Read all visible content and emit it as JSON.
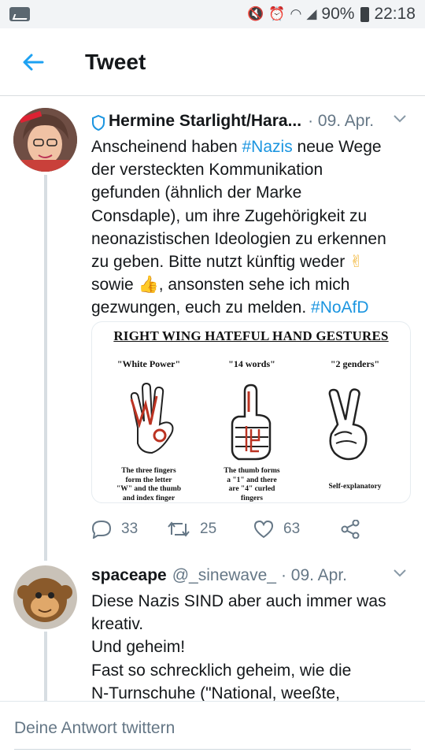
{
  "status_bar": {
    "battery": "90%",
    "time": "22:18",
    "icons": [
      "mute-icon",
      "alarm-icon",
      "wifi-icon",
      "signal-icon",
      "battery-icon"
    ]
  },
  "header": {
    "title": "Tweet",
    "back_icon": "back-arrow-icon"
  },
  "tweets": [
    {
      "name": "Hermine Starlight/Hara...",
      "date": "· 09. Apr.",
      "lines": [
        [
          "Anscheinend haben ",
          "#Nazis",
          " neue Wege"
        ],
        [
          "der versteckten Kommunikation"
        ],
        [
          "gefunden (ähnlich der Marke"
        ],
        [
          "Consdaple), um ihre Zugehörigkeit zu"
        ],
        [
          "neonazistischen Ideologien zu erkennen"
        ],
        [
          "zu geben. Bitte nutzt künftig weder ",
          "✌"
        ],
        [
          "sowie ",
          "👍",
          ", ansonsten sehe ich mich"
        ],
        [
          "gezwungen, euch zu melden. ",
          "#NoAfD"
        ]
      ],
      "card": {
        "title": "RIGHT WING HATEFUL HAND GESTURES",
        "gestures": [
          {
            "label": "\"White Power\"",
            "caption": [
              "The three fingers",
              "form the letter",
              "\"W\" and the thumb",
              "and index finger"
            ]
          },
          {
            "label": "\"14 words\"",
            "caption": [
              "The thumb forms",
              "a \"1\" and there",
              "are \"4\" curled",
              "fingers"
            ]
          },
          {
            "label": "\"2 genders\"",
            "caption": [
              "Self-explanatory"
            ]
          }
        ]
      },
      "actions": {
        "replies": "33",
        "retweets": "25",
        "likes": "63"
      }
    },
    {
      "name": "spaceape",
      "handle": "@_sinewave_",
      "date": "· 09. Apr.",
      "lines": [
        [
          "Diese Nazis SIND aber auch immer was"
        ],
        [
          "kreativ."
        ],
        [
          "Und geheim!"
        ],
        [
          "Fast so schrecklich geheim, wie die"
        ],
        [
          "N-Turnschuhe (\"National, weeßte,"
        ]
      ]
    }
  ],
  "reply_bar": {
    "placeholder": "Deine Antwort twittern"
  },
  "colors": {
    "accent": "#1da1f2",
    "hashtag": "#1b95e0",
    "secondary": "#657786"
  }
}
